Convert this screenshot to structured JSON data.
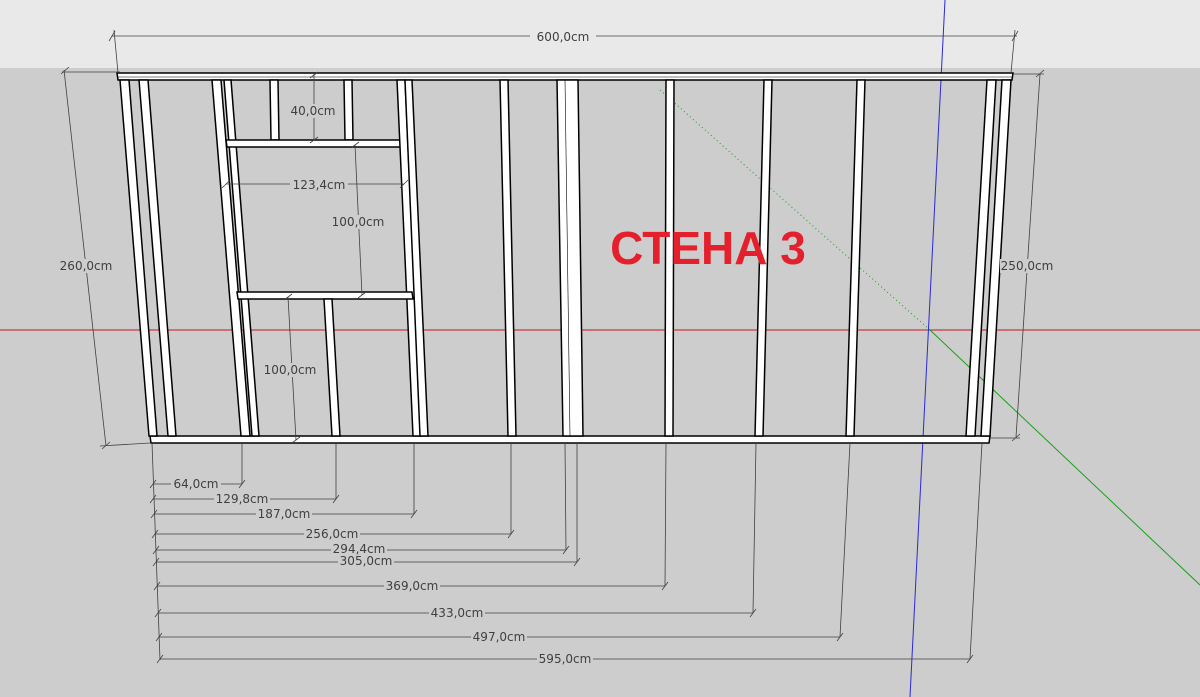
{
  "title": "СТЕНА 3",
  "colors": {
    "sky": "#e9e9e9",
    "ground": "#cdcdcd",
    "title": "#e3202c",
    "axis_red": "#c8141e",
    "axis_green": "#1aa01a",
    "axis_blue": "#2a2ad4",
    "dimension": "#404040"
  },
  "dimensions": {
    "overall_width": "600,0cm",
    "left_height": "260,0cm",
    "right_height": "250,0cm",
    "window_top_spacing": "40,0cm",
    "window_width": "123,4cm",
    "window_height": "100,0cm",
    "sill_height": "100,0cm"
  },
  "stud_offsets": [
    "64,0cm",
    "129,8cm",
    "187,0cm",
    "256,0cm",
    "294,4cm",
    "305,0cm",
    "369,0cm",
    "433,0cm",
    "497,0cm",
    "595,0cm"
  ]
}
